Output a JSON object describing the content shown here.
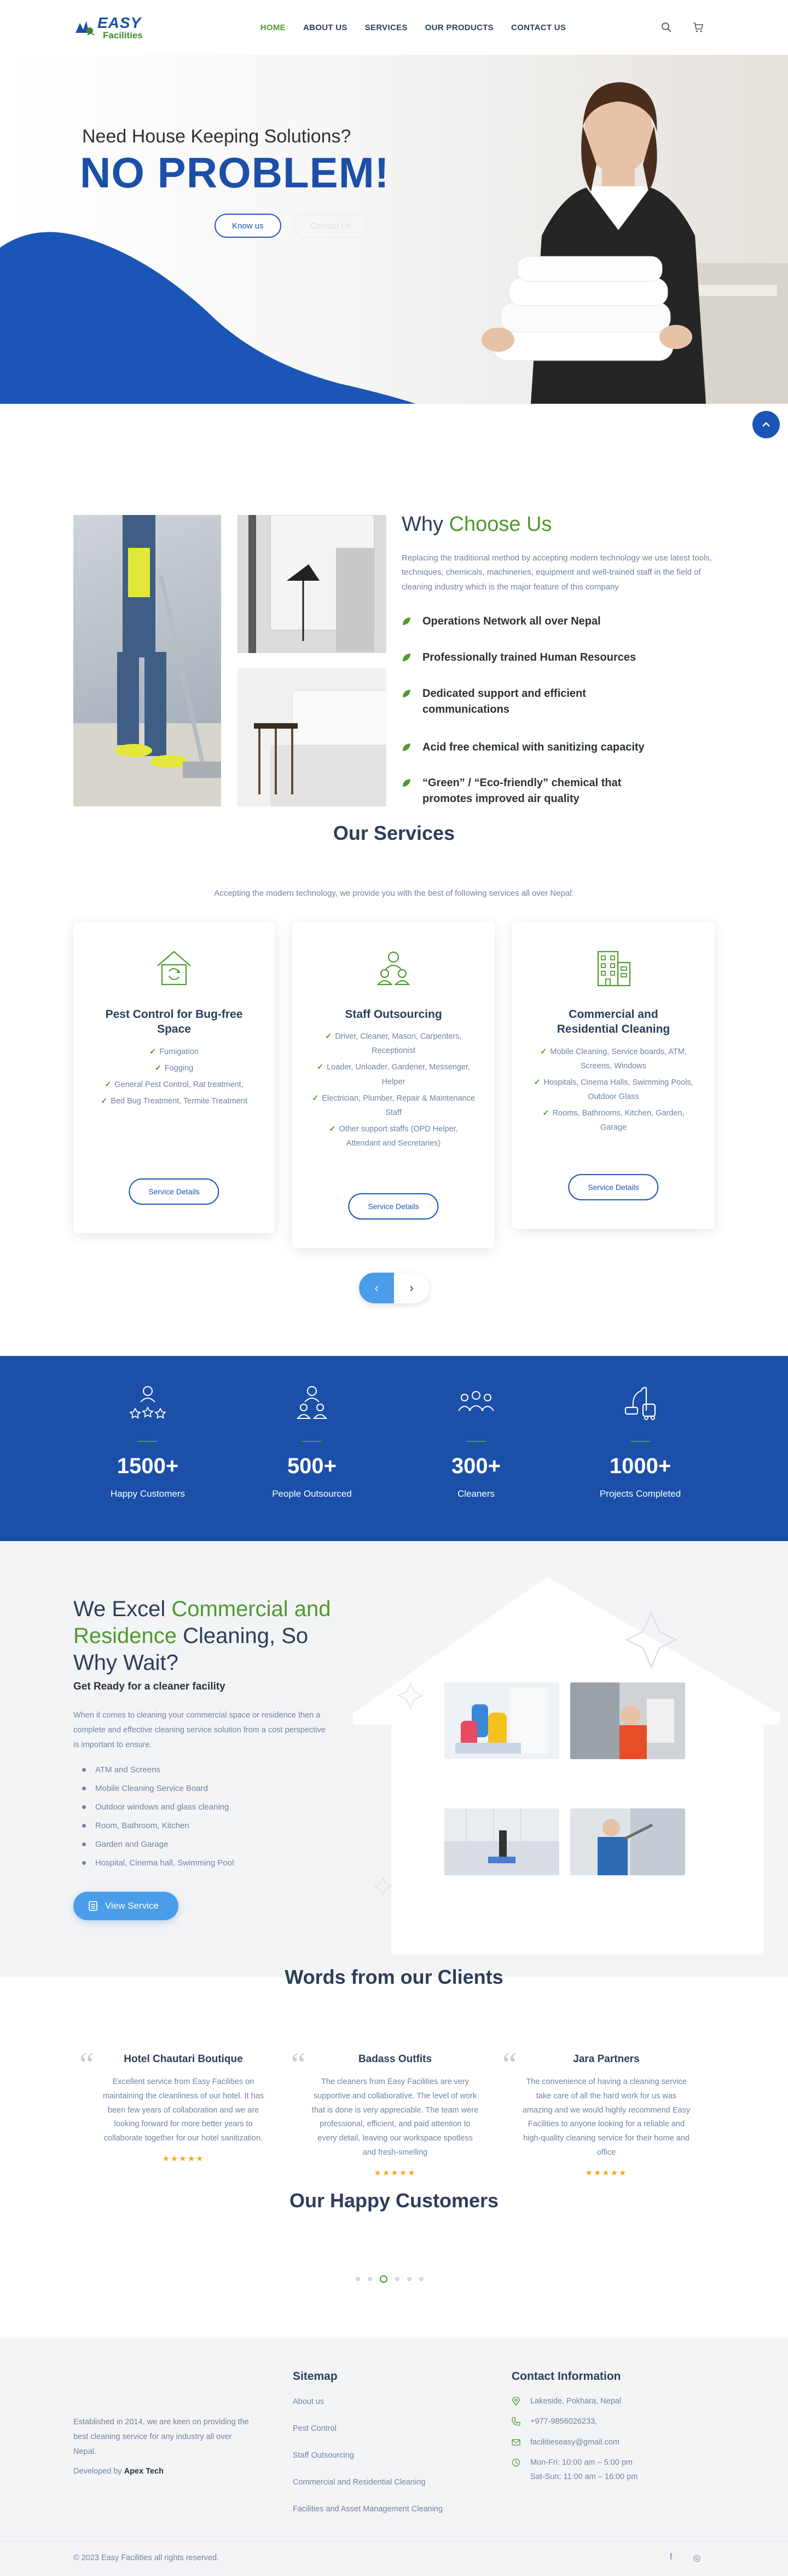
{
  "header": {
    "logo_top": "EASY",
    "logo_bottom": "Facilities",
    "nav": [
      "HOME",
      "ABOUT US",
      "SERVICES",
      "OUR PRODUCTS",
      "CONTACT US"
    ],
    "active_nav": "HOME"
  },
  "hero": {
    "subtitle": "Need House Keeping Solutions?",
    "title": "NO PROBLEM!",
    "btn_primary": "Know us",
    "btn_secondary": "Contact Us"
  },
  "why": {
    "title_plain": "Why ",
    "title_accent": "Choose Us",
    "description": "Replacing the traditional method by accepting modern technology we use latest tools, techniques, chemicals, machineries, equipment and well-trained staff in the field of cleaning industry which is the major feature of this company",
    "items": [
      "Operations Network all over Nepal",
      "Professionally trained Human Resources",
      "Dedicated support and efficient communications",
      "Acid free chemical with sanitizing capacity",
      "“Green” / “Eco-friendly” chemical that promotes improved air quality"
    ]
  },
  "services": {
    "title": "Our Services",
    "subtitle": "Accepting the modern technology, we provide you with the best of following services all over Nepal:",
    "details_label": "Service Details",
    "cards": [
      {
        "title": "Pest Control for Bug-free Space",
        "items": [
          "Fumigation",
          "Fogging",
          "General Pest Control, Rat treatment,",
          "Bed Bug Treatment, Termite Treatment"
        ]
      },
      {
        "title": "Staff Outsourcing",
        "items": [
          "Driver, Cleaner, Mason, Carpenters, Receptionist",
          "Loader, Unloader, Gardener, Messenger, Helper",
          "Electrician, Plumber, Repair & Maintenance Staff",
          "Other support staffs (OPD Helper, Attendant and Secretaries)"
        ]
      },
      {
        "title": "Commercial and Residential Cleaning",
        "items": [
          "Mobile Cleaning, Service boards, ATM, Screens, Windows",
          "Hospitals, Cinema Halls, Swimming Pools, Outdoor Glass",
          "Rooms, Bathrooms, Kitchen, Garden, Garage"
        ]
      }
    ],
    "prev": "‹",
    "next": "›"
  },
  "stats": [
    {
      "value": "1500+",
      "label": "Happy Customers",
      "icon": "customers-stars-icon"
    },
    {
      "value": "500+",
      "label": "People Outsourced",
      "icon": "people-outsourced-icon"
    },
    {
      "value": "300+",
      "label": "Cleaners",
      "icon": "cleaners-group-icon"
    },
    {
      "value": "1000+",
      "label": "Projects Completed",
      "icon": "vacuum-cleaner-icon"
    }
  ],
  "excel": {
    "title_1": "We Excel ",
    "title_accent": "Commercial and Residence",
    "title_2": " Cleaning, So Why Wait?",
    "subtitle": "Get Ready for a cleaner facility",
    "description": "When it comes to cleaning your commercial space or residence then a complete and effective cleaning service solution from a cost perspective is important to ensure.",
    "items": [
      "ATM and Screens",
      "Mobile Cleaning Service Board",
      "Outdoor windows and glass cleaning",
      "Room, Bathroom, Kitchen",
      "Garden and Garage",
      "Hospital, Cinema hall, Swimming Pool"
    ],
    "button": "View Service"
  },
  "testimonials": {
    "title": "Words from our Clients",
    "items": [
      {
        "name": "Hotel Chautari Boutique",
        "text": "Excellent service from Easy Facilities on maintaining the cleanliness of our hotel. It has been few years of collaboration and we are looking forward for more better years to collaborate together for our hotel sanitization.",
        "stars": "★★★★★"
      },
      {
        "name": "Badass Outfits",
        "text": "The cleaners from Easy Facilities are very supportive and collaborative. The level of work that is done is very appreciable. The team were professional, efficient, and paid attention to every detail, leaving our workspace spotless and fresh-smelling",
        "stars": "★★★★★"
      },
      {
        "name": "Jara Partners",
        "text": "The convenience of having a cleaning service take care of all the hard work for us was amazing and we would highly recommend Easy Facilities to anyone looking for a reliable and high-quality cleaning service for their home and office",
        "stars": "★★★★★"
      }
    ]
  },
  "customers": {
    "title": "Our Happy Customers"
  },
  "footer": {
    "about": "Established in 2014, we are keen on providing the best cleaning service for any industry all over Nepal.",
    "developed_prefix": "Developed by ",
    "developer": "Apex Tech",
    "sitemap_title": "Sitemap",
    "sitemap": [
      "About us",
      "Pest Control",
      "Staff Outsourcing",
      "Commercial and Residential Cleaning",
      "Facilities and Asset Management Cleaning"
    ],
    "contact_title": "Contact Information",
    "address": "Lakeside, Pokhara, Nepal",
    "phone": "+977-9856026233,",
    "email": "facilitieseasy@gmail.com",
    "hours_1": "Mon-Fri: 10:00 am – 5:00 pm",
    "hours_2": "Sat-Sun: 11:00 am – 16:00 pm",
    "copyright": "© 2023 Easy Facilities all rights reserved.",
    "social_facebook": "f",
    "social_instagram": "◎"
  },
  "colors": {
    "brand_blue": "#1b4fa8",
    "accent_green": "#4f9a2e",
    "button_blue": "#4a9de8",
    "text_muted": "#6f84a3"
  }
}
